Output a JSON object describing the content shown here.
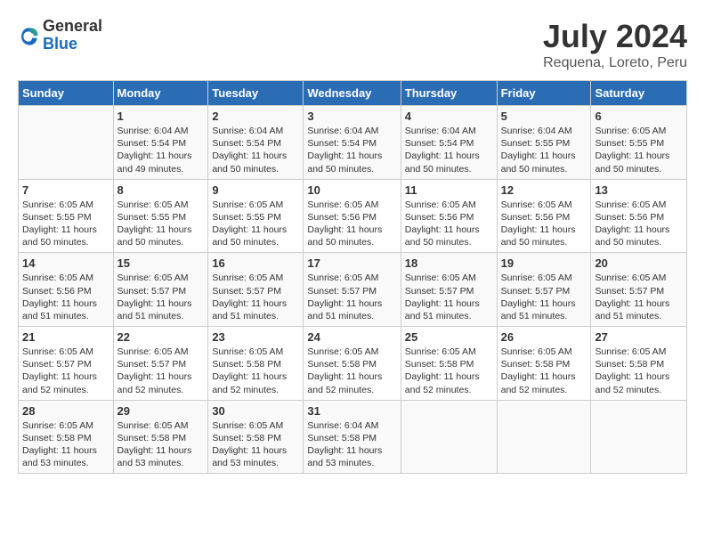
{
  "header": {
    "logo_general": "General",
    "logo_blue": "Blue",
    "month_title": "July 2024",
    "location": "Requena, Loreto, Peru"
  },
  "calendar": {
    "days_of_week": [
      "Sunday",
      "Monday",
      "Tuesday",
      "Wednesday",
      "Thursday",
      "Friday",
      "Saturday"
    ],
    "weeks": [
      [
        {
          "day": "",
          "sunrise": "",
          "sunset": "",
          "daylight": ""
        },
        {
          "day": "1",
          "sunrise": "Sunrise: 6:04 AM",
          "sunset": "Sunset: 5:54 PM",
          "daylight": "Daylight: 11 hours and 49 minutes."
        },
        {
          "day": "2",
          "sunrise": "Sunrise: 6:04 AM",
          "sunset": "Sunset: 5:54 PM",
          "daylight": "Daylight: 11 hours and 50 minutes."
        },
        {
          "day": "3",
          "sunrise": "Sunrise: 6:04 AM",
          "sunset": "Sunset: 5:54 PM",
          "daylight": "Daylight: 11 hours and 50 minutes."
        },
        {
          "day": "4",
          "sunrise": "Sunrise: 6:04 AM",
          "sunset": "Sunset: 5:54 PM",
          "daylight": "Daylight: 11 hours and 50 minutes."
        },
        {
          "day": "5",
          "sunrise": "Sunrise: 6:04 AM",
          "sunset": "Sunset: 5:55 PM",
          "daylight": "Daylight: 11 hours and 50 minutes."
        },
        {
          "day": "6",
          "sunrise": "Sunrise: 6:05 AM",
          "sunset": "Sunset: 5:55 PM",
          "daylight": "Daylight: 11 hours and 50 minutes."
        }
      ],
      [
        {
          "day": "7",
          "sunrise": "Sunrise: 6:05 AM",
          "sunset": "Sunset: 5:55 PM",
          "daylight": "Daylight: 11 hours and 50 minutes."
        },
        {
          "day": "8",
          "sunrise": "Sunrise: 6:05 AM",
          "sunset": "Sunset: 5:55 PM",
          "daylight": "Daylight: 11 hours and 50 minutes."
        },
        {
          "day": "9",
          "sunrise": "Sunrise: 6:05 AM",
          "sunset": "Sunset: 5:55 PM",
          "daylight": "Daylight: 11 hours and 50 minutes."
        },
        {
          "day": "10",
          "sunrise": "Sunrise: 6:05 AM",
          "sunset": "Sunset: 5:56 PM",
          "daylight": "Daylight: 11 hours and 50 minutes."
        },
        {
          "day": "11",
          "sunrise": "Sunrise: 6:05 AM",
          "sunset": "Sunset: 5:56 PM",
          "daylight": "Daylight: 11 hours and 50 minutes."
        },
        {
          "day": "12",
          "sunrise": "Sunrise: 6:05 AM",
          "sunset": "Sunset: 5:56 PM",
          "daylight": "Daylight: 11 hours and 50 minutes."
        },
        {
          "day": "13",
          "sunrise": "Sunrise: 6:05 AM",
          "sunset": "Sunset: 5:56 PM",
          "daylight": "Daylight: 11 hours and 50 minutes."
        }
      ],
      [
        {
          "day": "14",
          "sunrise": "Sunrise: 6:05 AM",
          "sunset": "Sunset: 5:56 PM",
          "daylight": "Daylight: 11 hours and 51 minutes."
        },
        {
          "day": "15",
          "sunrise": "Sunrise: 6:05 AM",
          "sunset": "Sunset: 5:57 PM",
          "daylight": "Daylight: 11 hours and 51 minutes."
        },
        {
          "day": "16",
          "sunrise": "Sunrise: 6:05 AM",
          "sunset": "Sunset: 5:57 PM",
          "daylight": "Daylight: 11 hours and 51 minutes."
        },
        {
          "day": "17",
          "sunrise": "Sunrise: 6:05 AM",
          "sunset": "Sunset: 5:57 PM",
          "daylight": "Daylight: 11 hours and 51 minutes."
        },
        {
          "day": "18",
          "sunrise": "Sunrise: 6:05 AM",
          "sunset": "Sunset: 5:57 PM",
          "daylight": "Daylight: 11 hours and 51 minutes."
        },
        {
          "day": "19",
          "sunrise": "Sunrise: 6:05 AM",
          "sunset": "Sunset: 5:57 PM",
          "daylight": "Daylight: 11 hours and 51 minutes."
        },
        {
          "day": "20",
          "sunrise": "Sunrise: 6:05 AM",
          "sunset": "Sunset: 5:57 PM",
          "daylight": "Daylight: 11 hours and 51 minutes."
        }
      ],
      [
        {
          "day": "21",
          "sunrise": "Sunrise: 6:05 AM",
          "sunset": "Sunset: 5:57 PM",
          "daylight": "Daylight: 11 hours and 52 minutes."
        },
        {
          "day": "22",
          "sunrise": "Sunrise: 6:05 AM",
          "sunset": "Sunset: 5:57 PM",
          "daylight": "Daylight: 11 hours and 52 minutes."
        },
        {
          "day": "23",
          "sunrise": "Sunrise: 6:05 AM",
          "sunset": "Sunset: 5:58 PM",
          "daylight": "Daylight: 11 hours and 52 minutes."
        },
        {
          "day": "24",
          "sunrise": "Sunrise: 6:05 AM",
          "sunset": "Sunset: 5:58 PM",
          "daylight": "Daylight: 11 hours and 52 minutes."
        },
        {
          "day": "25",
          "sunrise": "Sunrise: 6:05 AM",
          "sunset": "Sunset: 5:58 PM",
          "daylight": "Daylight: 11 hours and 52 minutes."
        },
        {
          "day": "26",
          "sunrise": "Sunrise: 6:05 AM",
          "sunset": "Sunset: 5:58 PM",
          "daylight": "Daylight: 11 hours and 52 minutes."
        },
        {
          "day": "27",
          "sunrise": "Sunrise: 6:05 AM",
          "sunset": "Sunset: 5:58 PM",
          "daylight": "Daylight: 11 hours and 52 minutes."
        }
      ],
      [
        {
          "day": "28",
          "sunrise": "Sunrise: 6:05 AM",
          "sunset": "Sunset: 5:58 PM",
          "daylight": "Daylight: 11 hours and 53 minutes."
        },
        {
          "day": "29",
          "sunrise": "Sunrise: 6:05 AM",
          "sunset": "Sunset: 5:58 PM",
          "daylight": "Daylight: 11 hours and 53 minutes."
        },
        {
          "day": "30",
          "sunrise": "Sunrise: 6:05 AM",
          "sunset": "Sunset: 5:58 PM",
          "daylight": "Daylight: 11 hours and 53 minutes."
        },
        {
          "day": "31",
          "sunrise": "Sunrise: 6:04 AM",
          "sunset": "Sunset: 5:58 PM",
          "daylight": "Daylight: 11 hours and 53 minutes."
        },
        {
          "day": "",
          "sunrise": "",
          "sunset": "",
          "daylight": ""
        },
        {
          "day": "",
          "sunrise": "",
          "sunset": "",
          "daylight": ""
        },
        {
          "day": "",
          "sunrise": "",
          "sunset": "",
          "daylight": ""
        }
      ]
    ]
  }
}
